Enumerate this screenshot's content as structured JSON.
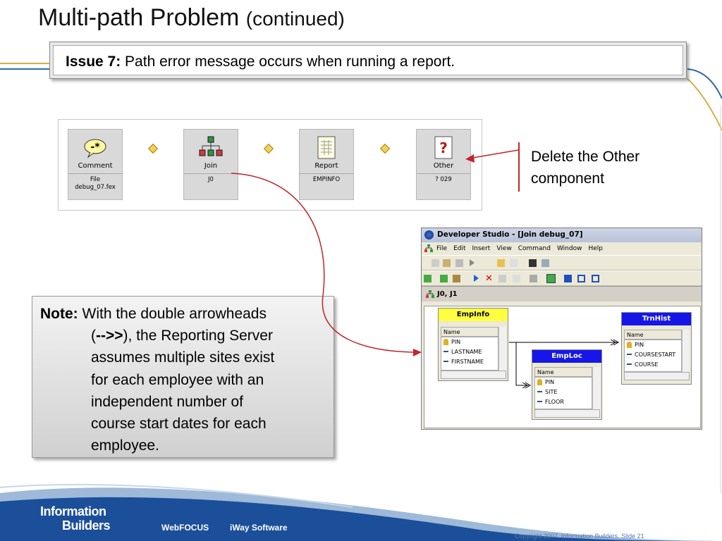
{
  "title": {
    "main": "Multi-path Problem",
    "sub": "(continued)"
  },
  "issue": {
    "label": "Issue 7:",
    "text": " Path error message occurs when running a report."
  },
  "components": [
    {
      "label": "Comment",
      "sub1": "File",
      "sub2": "debug_07.fex"
    },
    {
      "label": "Join",
      "sub1": "J0",
      "sub2": ""
    },
    {
      "label": "Report",
      "sub1": "EMPINFO",
      "sub2": ""
    },
    {
      "label": "Other",
      "sub1": "? 029",
      "sub2": ""
    }
  ],
  "callout": {
    "line1": "Delete the Other",
    "line2": "component"
  },
  "note": {
    "label": "Note:",
    "first": " With the double arrowheads",
    "lines": [
      "(-->>), the Reporting Server",
      "assumes multiple sites exist",
      "for each employee with an",
      "independent number of",
      "course start dates for each",
      "employee."
    ],
    "arrow_bold": "-->>"
  },
  "dev_studio": {
    "title": "Developer Studio - [Join debug_07]",
    "menu": [
      "File",
      "Edit",
      "Insert",
      "View",
      "Command",
      "Window",
      "Help"
    ],
    "subtitle": "J0, J1",
    "tables": [
      {
        "name": "EmpInfo",
        "column_header": "Name",
        "rows": [
          "PIN",
          "LASTNAME",
          "FIRSTNAME"
        ],
        "color": "#ffff40"
      },
      {
        "name": "EmpLoc",
        "column_header": "Name",
        "rows": [
          "PIN",
          "SITE",
          "FLOOR"
        ],
        "color": "#1616e8"
      },
      {
        "name": "TrnHist",
        "column_header": "Name",
        "rows": [
          "PIN",
          "COURSESTART",
          "COURSE"
        ],
        "color": "#1616e8"
      }
    ]
  },
  "footer": {
    "logo_line1": "Information",
    "logo_line2": "Builders",
    "product1": "WebFOCUS",
    "product2": "iWay Software",
    "copyright": "Copyright 2007, Information Builders. Slide 21"
  },
  "colors": {
    "accent_red": "#c0262b",
    "footer_blue": "#1b4f9a"
  }
}
